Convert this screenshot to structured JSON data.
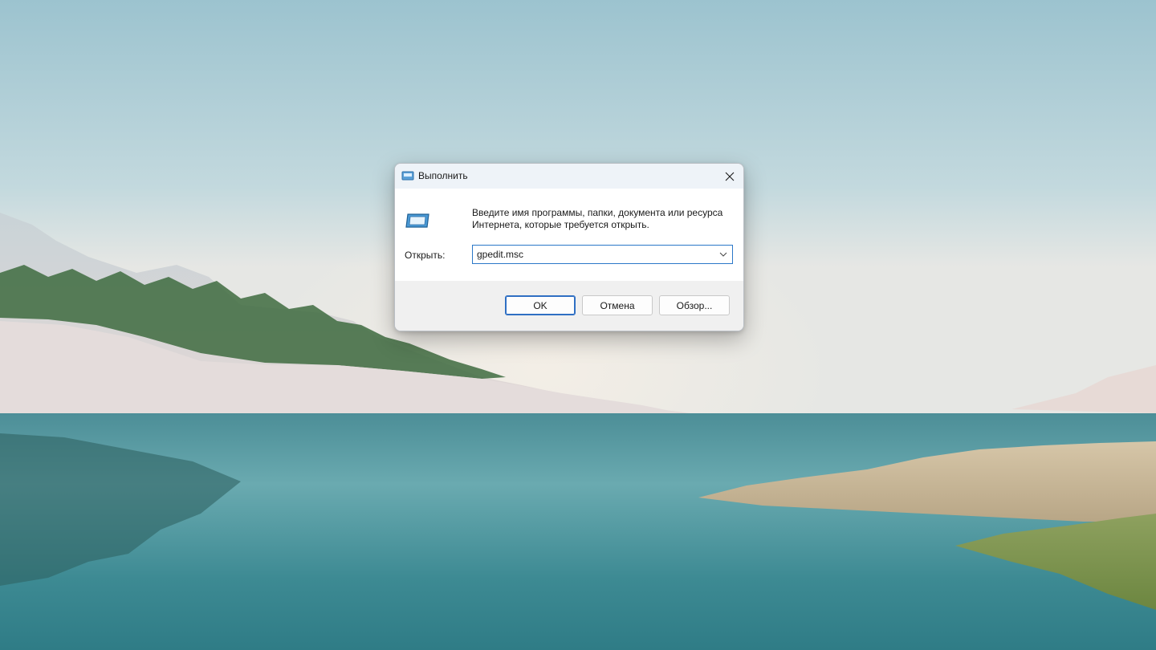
{
  "window": {
    "title": "Выполнить"
  },
  "dialog": {
    "description": "Введите имя программы, папки, документа или ресурса Интернета, которые требуется открыть.",
    "open_label": "Открыть:",
    "open_value": "gpedit.msc"
  },
  "buttons": {
    "ok": "OK",
    "cancel": "Отмена",
    "browse": "Обзор..."
  },
  "icons": {
    "title": "run-icon",
    "close": "close-icon",
    "dropdown": "chevron-down-icon",
    "program": "run-program-icon"
  },
  "colors": {
    "accent": "#2f6fc3",
    "dialog_bg": "#f0f0f0",
    "content_bg": "#ffffff"
  }
}
